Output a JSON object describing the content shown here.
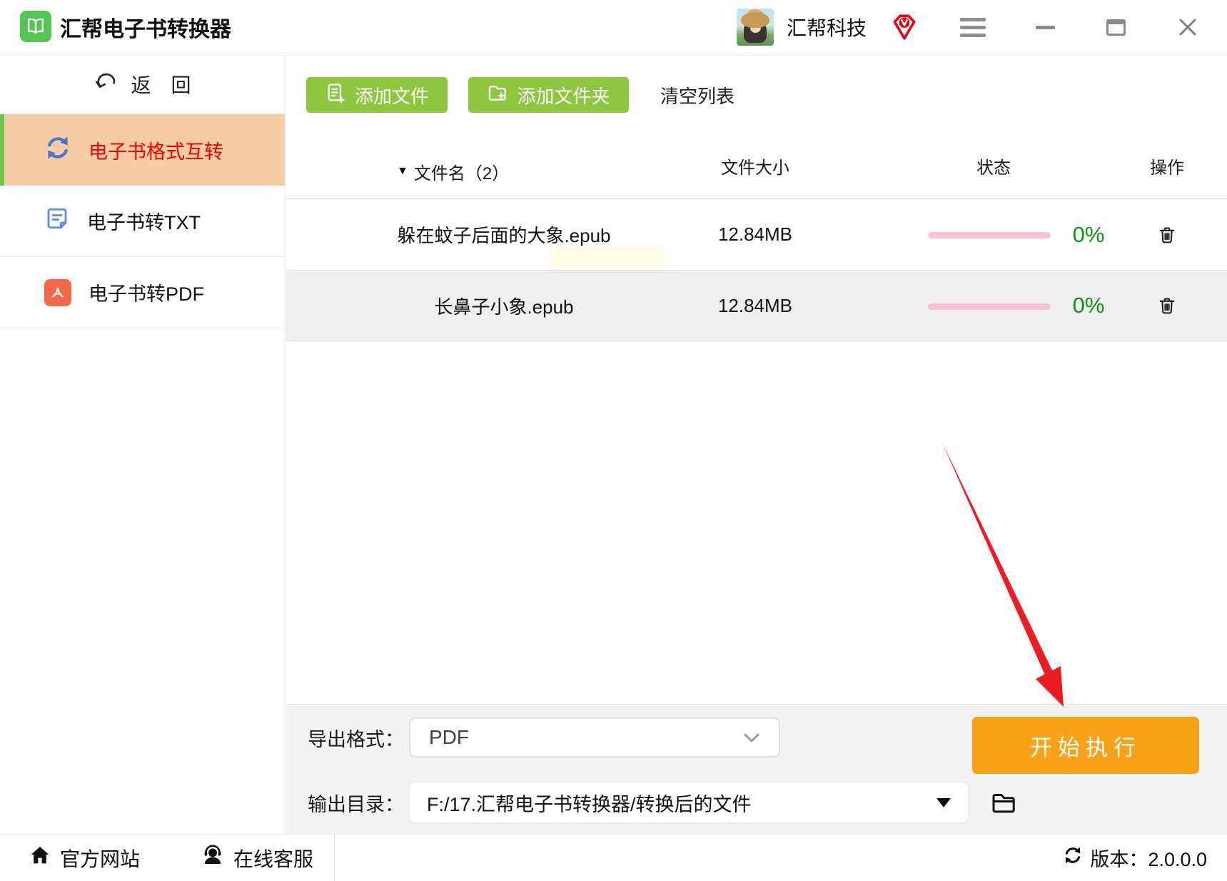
{
  "titlebar": {
    "app_title": "汇帮电子书转换器",
    "brand": "汇帮科技"
  },
  "sidebar": {
    "back_label": "返　回",
    "items": [
      {
        "label": "电子书格式互转",
        "active": true
      },
      {
        "label": "电子书转TXT",
        "active": false
      },
      {
        "label": "电子书转PDF",
        "active": false
      }
    ]
  },
  "toolbar": {
    "add_file_label": "添加文件",
    "add_folder_label": "添加文件夹",
    "clear_label": "清空列表"
  },
  "table": {
    "sort_glyph": "▼",
    "headers": {
      "name": "文件名（2）",
      "size": "文件大小",
      "status": "状态",
      "action": "操作"
    },
    "rows": [
      {
        "name": "躲在蚊子后面的大象.epub",
        "size": "12.84MB",
        "percent": "0%",
        "progress": 0
      },
      {
        "name": "长鼻子小象.epub",
        "size": "12.84MB",
        "percent": "0%",
        "progress": 0
      }
    ]
  },
  "bottom_panel": {
    "export_label": "导出格式：",
    "export_value": "PDF",
    "output_label": "输出目录：",
    "output_value": "F:/17.汇帮电子书转换器/转换后的文件",
    "start_label": "开始执行"
  },
  "footer": {
    "website_label": "官方网站",
    "support_label": "在线客服",
    "version_text": "版本：2.0.0.0"
  },
  "icons": {
    "logo": "open-book",
    "vip": "vip-gem-badge",
    "sidebar_active": "refresh-arrows",
    "sidebar_txt": "document-lines",
    "sidebar_pdf": "pdf-badge",
    "row_action": "trash-can"
  },
  "colors": {
    "button_green": "#8dc63f",
    "start_orange": "#f7a217",
    "selected_bg": "#f6cda4",
    "selected_text": "#f40000",
    "progress_pink": "#f8c2d4",
    "percent_green": "#0f930f",
    "arrow_red": "#ec1c24",
    "logo_green": "#52c552",
    "vip_red": "#e60012",
    "refresh_blue": "#4a77d6",
    "pdf_icon_red": "#f4694c"
  }
}
